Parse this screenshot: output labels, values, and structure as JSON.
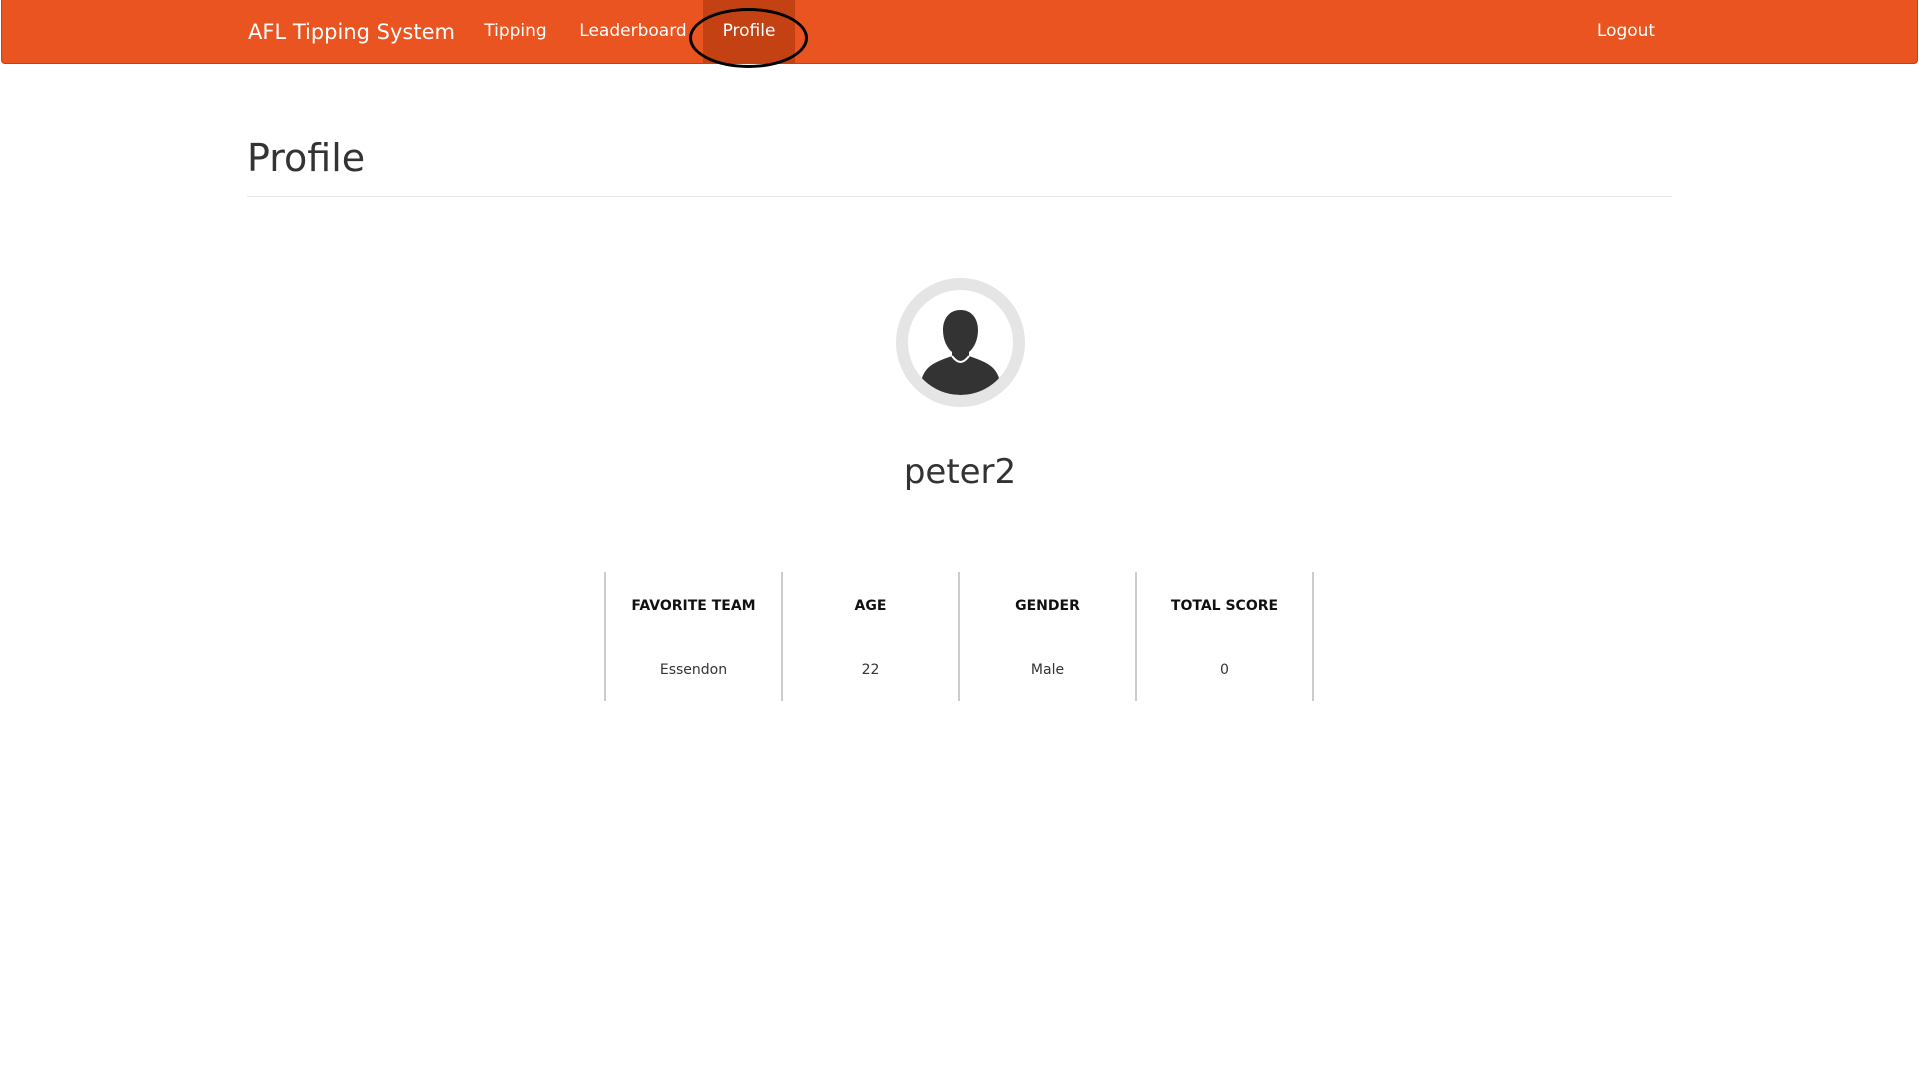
{
  "navbar": {
    "brand": "AFL Tipping System",
    "links": {
      "tipping": "Tipping",
      "leaderboard": "Leaderboard",
      "profile": "Profile"
    },
    "logout": "Logout",
    "active": "profile",
    "color": "#e95420",
    "active_color": "#c34113"
  },
  "page": {
    "title": "Profile"
  },
  "profile": {
    "avatar_icon": "user-silhouette-icon",
    "username": "peter2",
    "stats": [
      {
        "label": "FAVORITE TEAM",
        "value": "Essendon"
      },
      {
        "label": "AGE",
        "value": "22"
      },
      {
        "label": "GENDER",
        "value": "Male"
      },
      {
        "label": "TOTAL SCORE",
        "value": "0"
      }
    ]
  }
}
